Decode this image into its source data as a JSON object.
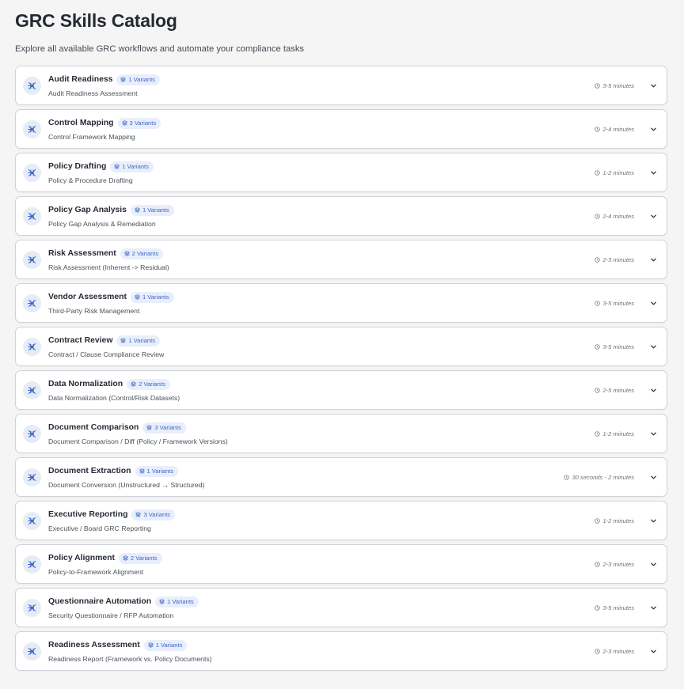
{
  "header": {
    "title": "GRC Skills Catalog",
    "subtitle": "Explore all available GRC workflows and automate your compliance tasks"
  },
  "colors": {
    "accent": "#3e66c9",
    "badge_bg": "#e8eefb",
    "icon_bg": "#e6ecf6"
  },
  "icons": {
    "skill": "skill-network-icon",
    "variants": "layers-icon",
    "duration": "clock-icon",
    "expand": "chevron-down-icon"
  },
  "skills": [
    {
      "name": "Audit Readiness",
      "variants": "1 Variants",
      "description": "Audit Readiness Assessment",
      "duration": "3-5 minutes"
    },
    {
      "name": "Control Mapping",
      "variants": "3 Variants",
      "description": "Control Framework Mapping",
      "duration": "2-4 minutes"
    },
    {
      "name": "Policy Drafting",
      "variants": "1 Variants",
      "description": "Policy & Procedure Drafting",
      "duration": "1-2 minutes"
    },
    {
      "name": "Policy Gap Analysis",
      "variants": "1 Variants",
      "description": "Policy Gap Analysis & Remediation",
      "duration": "2-4 minutes"
    },
    {
      "name": "Risk Assessment",
      "variants": "2 Variants",
      "description": "Risk Assessment (Inherent -> Residual)",
      "duration": "2-3 minutes"
    },
    {
      "name": "Vendor Assessment",
      "variants": "1 Variants",
      "description": "Third-Party Risk Management",
      "duration": "3-5 minutes"
    },
    {
      "name": "Contract Review",
      "variants": "1 Variants",
      "description": "Contract / Clause Compliance Review",
      "duration": "3-5 minutes"
    },
    {
      "name": "Data Normalization",
      "variants": "2 Variants",
      "description": "Data Normalization (Control/Risk Datasets)",
      "duration": "2-5 minutes"
    },
    {
      "name": "Document Comparison",
      "variants": "3 Variants",
      "description": "Document Comparison / Diff (Policy / Framework Versions)",
      "duration": "1-2 minutes"
    },
    {
      "name": "Document Extraction",
      "variants": "1 Variants",
      "description": "Document Conversion (Unstructured → Structured)",
      "duration": "30 seconds - 2 minutes"
    },
    {
      "name": "Executive Reporting",
      "variants": "3 Variants",
      "description": "Executive / Board GRC Reporting",
      "duration": "1-2 minutes"
    },
    {
      "name": "Policy Alignment",
      "variants": "2 Variants",
      "description": "Policy-to-Framework Alignment",
      "duration": "2-3 minutes"
    },
    {
      "name": "Questionnaire Automation",
      "variants": "1 Variants",
      "description": "Security Questionnaire / RFP Automation",
      "duration": "3-5 minutes"
    },
    {
      "name": "Readiness Assessment",
      "variants": "1 Variants",
      "description": "Readiness Report (Framework vs. Policy Documents)",
      "duration": "2-3 minutes"
    }
  ]
}
